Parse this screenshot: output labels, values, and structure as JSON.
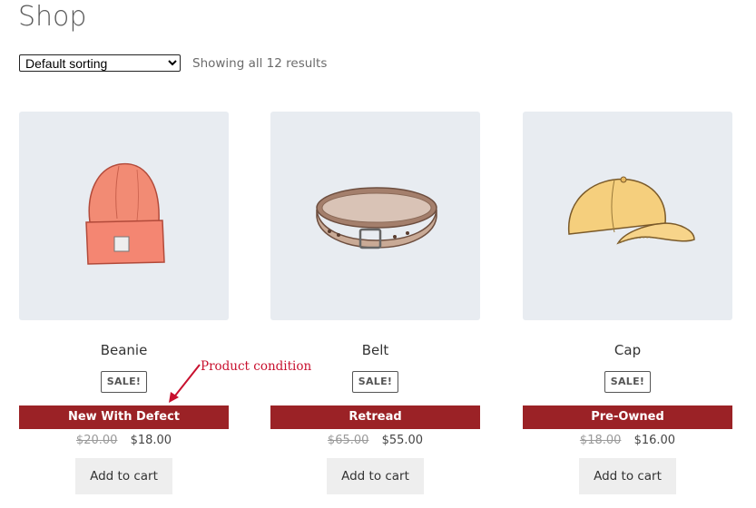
{
  "page": {
    "title": "Shop"
  },
  "toolbar": {
    "sort_selected": "Default sorting",
    "results_count": "Showing all 12 results"
  },
  "annotation": {
    "label": "Product condition",
    "color": "#c8102e"
  },
  "colors": {
    "condition_bar": "#9b2226",
    "image_bg": "#e8ecf1",
    "button_bg": "#eeeeee"
  },
  "products": [
    {
      "name": "Beanie",
      "badge": "SALE!",
      "condition": "New With Defect",
      "old_price": "$20.00",
      "price": "$18.00",
      "button": "Add to cart",
      "icon": "beanie-image"
    },
    {
      "name": "Belt",
      "badge": "SALE!",
      "condition": "Retread",
      "old_price": "$65.00",
      "price": "$55.00",
      "button": "Add to cart",
      "icon": "belt-image"
    },
    {
      "name": "Cap",
      "badge": "SALE!",
      "condition": "Pre-Owned",
      "old_price": "$18.00",
      "price": "$16.00",
      "button": "Add to cart",
      "icon": "cap-image"
    }
  ]
}
